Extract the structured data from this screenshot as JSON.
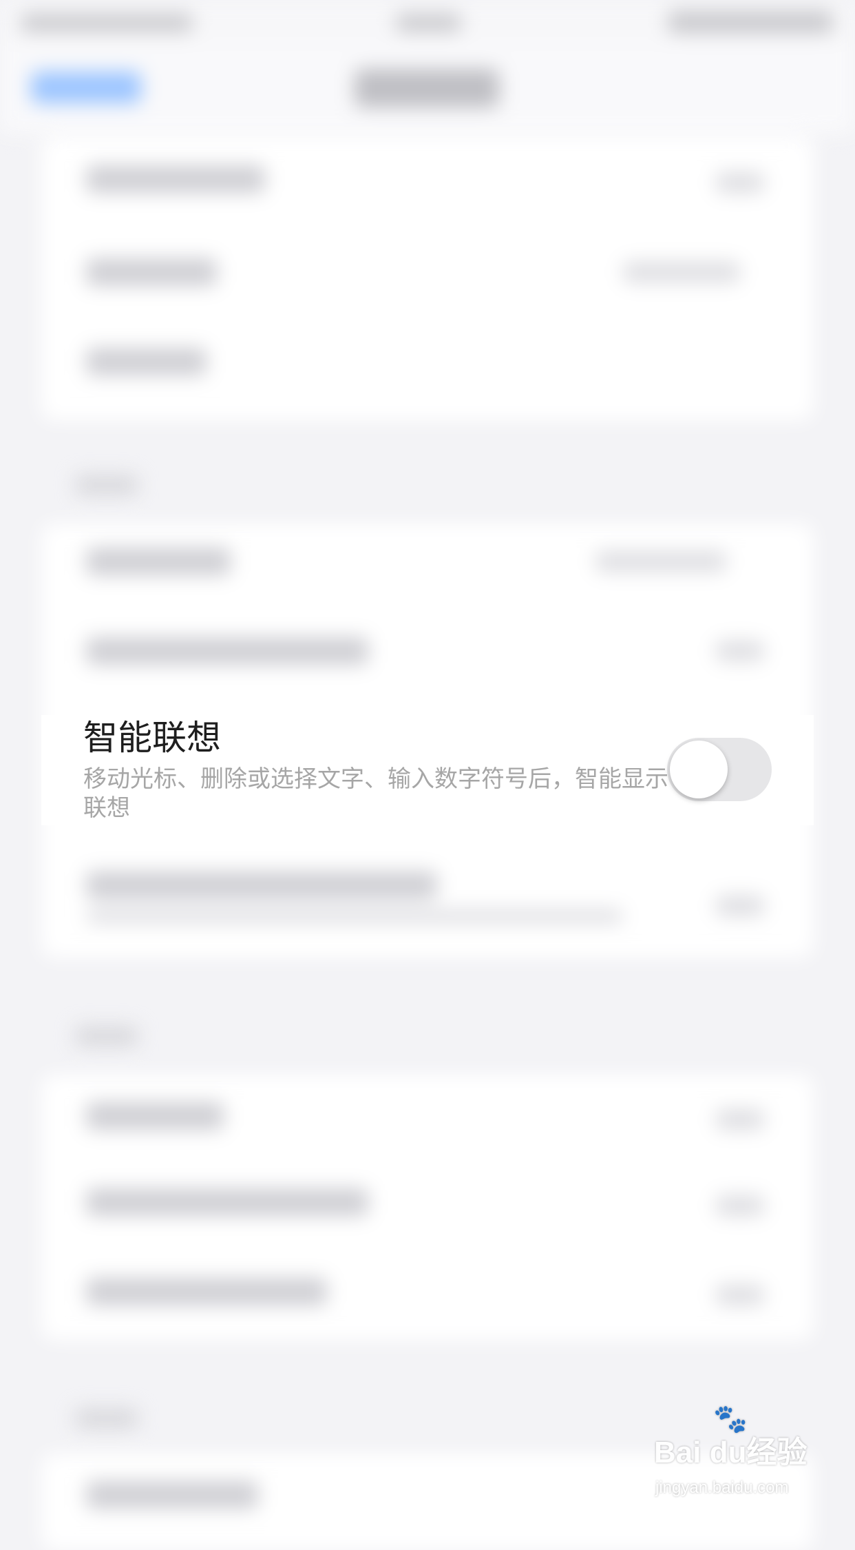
{
  "focused_setting": {
    "title": "智能联想",
    "description": "移动光标、删除或选择文字、输入数字符号后，智能显示联想",
    "toggle_on": false
  },
  "watermark": {
    "logo": "Bai du经验",
    "subtitle": "jingyan.baidu.com"
  },
  "colors": {
    "page_background": "#f3f3f6",
    "card_background": "#ffffff",
    "title_text": "#1e1e1e",
    "description_text": "#a6a6a6",
    "toggle_off_track": "#e6e6e8",
    "accent_blurred": "#9cc5ff"
  }
}
